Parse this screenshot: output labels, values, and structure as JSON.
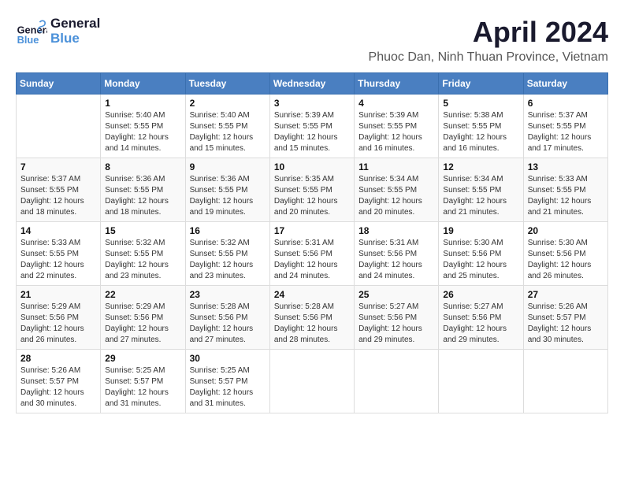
{
  "header": {
    "logo_general": "General",
    "logo_blue": "Blue",
    "title": "April 2024",
    "subtitle": "Phuoc Dan, Ninh Thuan Province, Vietnam"
  },
  "weekdays": [
    "Sunday",
    "Monday",
    "Tuesday",
    "Wednesday",
    "Thursday",
    "Friday",
    "Saturday"
  ],
  "weeks": [
    [
      {
        "day": "",
        "info": ""
      },
      {
        "day": "1",
        "info": "Sunrise: 5:40 AM\nSunset: 5:55 PM\nDaylight: 12 hours\nand 14 minutes."
      },
      {
        "day": "2",
        "info": "Sunrise: 5:40 AM\nSunset: 5:55 PM\nDaylight: 12 hours\nand 15 minutes."
      },
      {
        "day": "3",
        "info": "Sunrise: 5:39 AM\nSunset: 5:55 PM\nDaylight: 12 hours\nand 15 minutes."
      },
      {
        "day": "4",
        "info": "Sunrise: 5:39 AM\nSunset: 5:55 PM\nDaylight: 12 hours\nand 16 minutes."
      },
      {
        "day": "5",
        "info": "Sunrise: 5:38 AM\nSunset: 5:55 PM\nDaylight: 12 hours\nand 16 minutes."
      },
      {
        "day": "6",
        "info": "Sunrise: 5:37 AM\nSunset: 5:55 PM\nDaylight: 12 hours\nand 17 minutes."
      }
    ],
    [
      {
        "day": "7",
        "info": "Sunrise: 5:37 AM\nSunset: 5:55 PM\nDaylight: 12 hours\nand 18 minutes."
      },
      {
        "day": "8",
        "info": "Sunrise: 5:36 AM\nSunset: 5:55 PM\nDaylight: 12 hours\nand 18 minutes."
      },
      {
        "day": "9",
        "info": "Sunrise: 5:36 AM\nSunset: 5:55 PM\nDaylight: 12 hours\nand 19 minutes."
      },
      {
        "day": "10",
        "info": "Sunrise: 5:35 AM\nSunset: 5:55 PM\nDaylight: 12 hours\nand 20 minutes."
      },
      {
        "day": "11",
        "info": "Sunrise: 5:34 AM\nSunset: 5:55 PM\nDaylight: 12 hours\nand 20 minutes."
      },
      {
        "day": "12",
        "info": "Sunrise: 5:34 AM\nSunset: 5:55 PM\nDaylight: 12 hours\nand 21 minutes."
      },
      {
        "day": "13",
        "info": "Sunrise: 5:33 AM\nSunset: 5:55 PM\nDaylight: 12 hours\nand 21 minutes."
      }
    ],
    [
      {
        "day": "14",
        "info": "Sunrise: 5:33 AM\nSunset: 5:55 PM\nDaylight: 12 hours\nand 22 minutes."
      },
      {
        "day": "15",
        "info": "Sunrise: 5:32 AM\nSunset: 5:55 PM\nDaylight: 12 hours\nand 23 minutes."
      },
      {
        "day": "16",
        "info": "Sunrise: 5:32 AM\nSunset: 5:55 PM\nDaylight: 12 hours\nand 23 minutes."
      },
      {
        "day": "17",
        "info": "Sunrise: 5:31 AM\nSunset: 5:56 PM\nDaylight: 12 hours\nand 24 minutes."
      },
      {
        "day": "18",
        "info": "Sunrise: 5:31 AM\nSunset: 5:56 PM\nDaylight: 12 hours\nand 24 minutes."
      },
      {
        "day": "19",
        "info": "Sunrise: 5:30 AM\nSunset: 5:56 PM\nDaylight: 12 hours\nand 25 minutes."
      },
      {
        "day": "20",
        "info": "Sunrise: 5:30 AM\nSunset: 5:56 PM\nDaylight: 12 hours\nand 26 minutes."
      }
    ],
    [
      {
        "day": "21",
        "info": "Sunrise: 5:29 AM\nSunset: 5:56 PM\nDaylight: 12 hours\nand 26 minutes."
      },
      {
        "day": "22",
        "info": "Sunrise: 5:29 AM\nSunset: 5:56 PM\nDaylight: 12 hours\nand 27 minutes."
      },
      {
        "day": "23",
        "info": "Sunrise: 5:28 AM\nSunset: 5:56 PM\nDaylight: 12 hours\nand 27 minutes."
      },
      {
        "day": "24",
        "info": "Sunrise: 5:28 AM\nSunset: 5:56 PM\nDaylight: 12 hours\nand 28 minutes."
      },
      {
        "day": "25",
        "info": "Sunrise: 5:27 AM\nSunset: 5:56 PM\nDaylight: 12 hours\nand 29 minutes."
      },
      {
        "day": "26",
        "info": "Sunrise: 5:27 AM\nSunset: 5:56 PM\nDaylight: 12 hours\nand 29 minutes."
      },
      {
        "day": "27",
        "info": "Sunrise: 5:26 AM\nSunset: 5:57 PM\nDaylight: 12 hours\nand 30 minutes."
      }
    ],
    [
      {
        "day": "28",
        "info": "Sunrise: 5:26 AM\nSunset: 5:57 PM\nDaylight: 12 hours\nand 30 minutes."
      },
      {
        "day": "29",
        "info": "Sunrise: 5:25 AM\nSunset: 5:57 PM\nDaylight: 12 hours\nand 31 minutes."
      },
      {
        "day": "30",
        "info": "Sunrise: 5:25 AM\nSunset: 5:57 PM\nDaylight: 12 hours\nand 31 minutes."
      },
      {
        "day": "",
        "info": ""
      },
      {
        "day": "",
        "info": ""
      },
      {
        "day": "",
        "info": ""
      },
      {
        "day": "",
        "info": ""
      }
    ]
  ]
}
